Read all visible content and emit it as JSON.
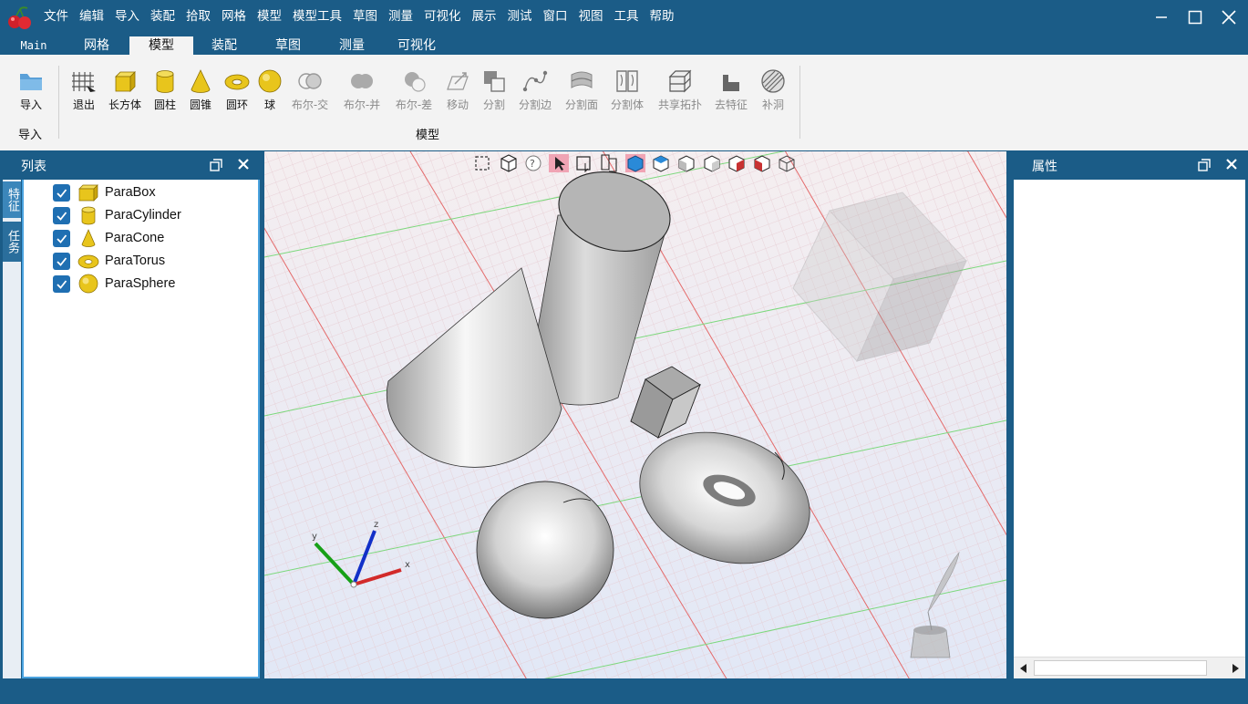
{
  "menu": [
    "文件",
    "编辑",
    "导入",
    "装配",
    "拾取",
    "网格",
    "模型",
    "模型工具",
    "草图",
    "测量",
    "可视化",
    "展示",
    "测试",
    "窗口",
    "视图",
    "工具",
    "帮助"
  ],
  "tabs": [
    "Main",
    "网格",
    "模型",
    "装配",
    "草图",
    "测量",
    "可视化"
  ],
  "active_tab": "模型",
  "ribbon": {
    "import_label": "导入",
    "import_group": "导入",
    "model_group": "模型",
    "buttons": [
      "退出",
      "长方体",
      "圆柱",
      "圆锥",
      "圆环",
      "球",
      "布尔-交",
      "布尔-并",
      "布尔-差",
      "移动",
      "分割",
      "分割边",
      "分割面",
      "分割体",
      "共享拓扑",
      "去特征",
      "补洞"
    ]
  },
  "left_panel": {
    "title": "列表",
    "vtabs": [
      "特征",
      "任务"
    ],
    "items": [
      "ParaBox",
      "ParaCylinder",
      "ParaCone",
      "ParaTorus",
      "ParaSphere"
    ]
  },
  "right_panel": {
    "title": "属性"
  },
  "axes": {
    "x": "x",
    "y": "y",
    "z": "z"
  },
  "colors": {
    "chrome": "#1b5c87",
    "accent": "#4aa3df",
    "checkbox": "#1f6fb2",
    "primitive": "#e8c51c"
  }
}
